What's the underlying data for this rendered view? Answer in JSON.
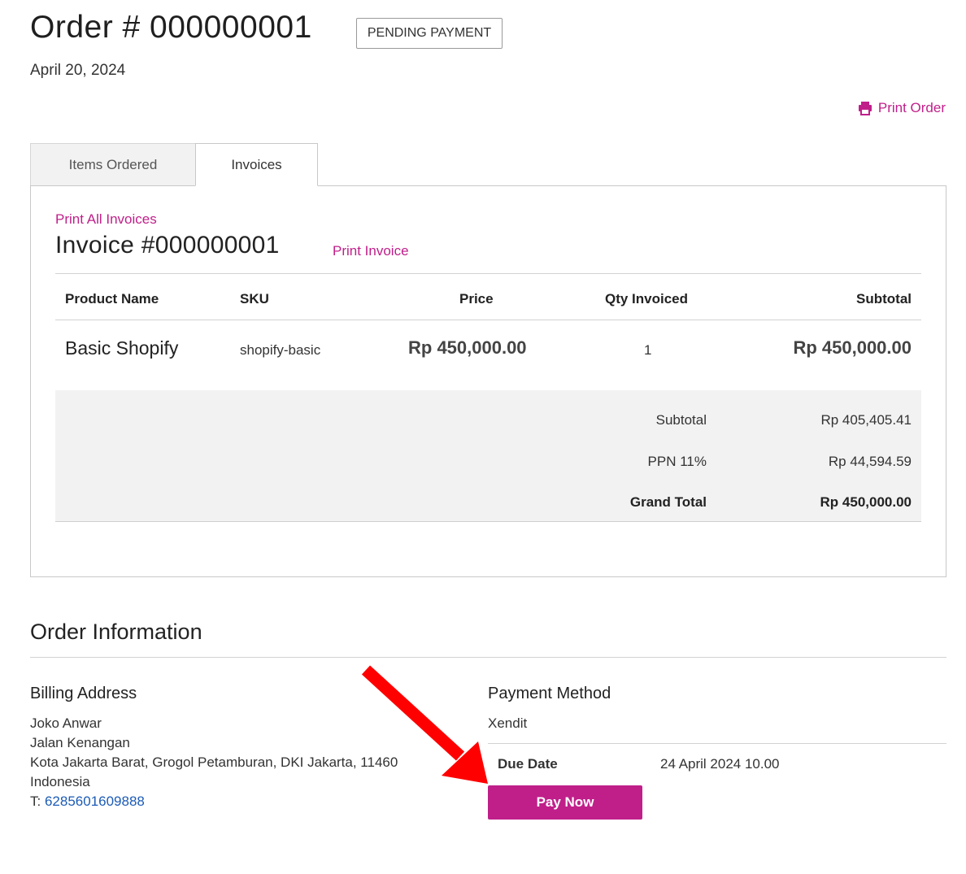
{
  "header": {
    "order_title": "Order # 000000001",
    "status": "PENDING PAYMENT",
    "date": "April 20, 2024",
    "print_order": "Print Order"
  },
  "tabs": [
    {
      "label": "Items Ordered",
      "active": false
    },
    {
      "label": "Invoices",
      "active": true
    }
  ],
  "invoice": {
    "print_all": "Print All Invoices",
    "title": "Invoice #000000001",
    "print_invoice": "Print Invoice",
    "columns": [
      "Product Name",
      "SKU",
      "Price",
      "Qty Invoiced",
      "Subtotal"
    ],
    "rows": [
      {
        "product": "Basic Shopify",
        "sku": "shopify-basic",
        "price": "Rp 450,000.00",
        "qty": "1",
        "subtotal": "Rp 450,000.00"
      }
    ],
    "totals": [
      {
        "label": "Subtotal",
        "value": "Rp 405,405.41"
      },
      {
        "label": "PPN 11%",
        "value": "Rp 44,594.59"
      },
      {
        "label": "Grand Total",
        "value": "Rp 450,000.00"
      }
    ]
  },
  "order_info": {
    "title": "Order Information",
    "billing": {
      "title": "Billing Address",
      "name": "Joko Anwar",
      "street": "Jalan Kenangan",
      "city": "Kota Jakarta Barat, Grogol Petamburan, DKI Jakarta, 11460",
      "country": "Indonesia",
      "phone_prefix": "T:",
      "phone": "6285601609888"
    },
    "payment": {
      "title": "Payment Method",
      "method": "Xendit",
      "due_label": "Due Date",
      "due_value": "24 April 2024 10.00",
      "pay_button": "Pay Now"
    }
  },
  "colors": {
    "accent": "#c01f8a",
    "link_blue": "#1c5bb6",
    "arrow": "#ff0000"
  },
  "icons": [
    "printer-icon",
    "red-arrow-annotation"
  ]
}
